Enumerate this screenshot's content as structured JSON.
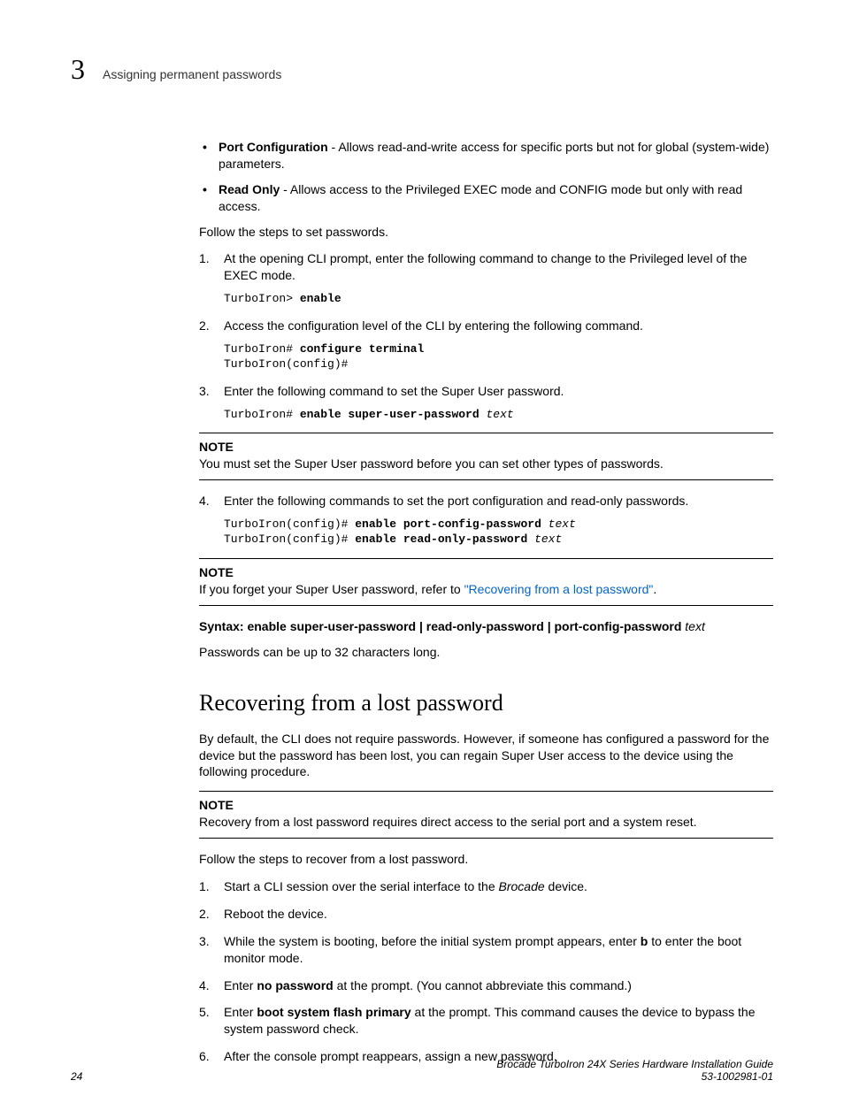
{
  "header": {
    "chapter": "3",
    "title": "Assigning permanent passwords"
  },
  "bullets": [
    {
      "term": "Port Configuration",
      "desc": " - Allows read-and-write access for specific ports but not for global (system-wide) parameters."
    },
    {
      "term": "Read Only",
      "desc": " - Allows access to the Privileged EXEC mode and CONFIG mode but only with read access."
    }
  ],
  "intro_follow": "Follow the steps to set passwords.",
  "steps": {
    "s1": "At the opening CLI prompt, enter the following command to change to the Privileged level of the EXEC mode.",
    "s1_code_prompt": "TurboIron> ",
    "s1_code_cmd": "enable",
    "s2": "Access the configuration level of the CLI by entering the following command.",
    "s2_code_l1_prompt": "TurboIron# ",
    "s2_code_l1_cmd": "configure terminal",
    "s2_code_l2": "TurboIron(config)#",
    "s3": "Enter the following command to set the Super User password.",
    "s3_code_prompt": "TurboIron# ",
    "s3_code_cmd": "enable super-user-password",
    "s3_code_arg": " text",
    "s4": "Enter the following commands to set the port configuration and read-only passwords.",
    "s4_code_l1_prompt": "TurboIron(config)# ",
    "s4_code_l1_cmd": "enable port-config-password",
    "s4_code_l1_arg": " text",
    "s4_code_l2_prompt": "TurboIron(config)# ",
    "s4_code_l2_cmd": "enable read-only-password",
    "s4_code_l2_arg": " text"
  },
  "note1": {
    "label": "NOTE",
    "text": "You must set the Super User password before you can set other types of passwords."
  },
  "note2": {
    "label": "NOTE",
    "text_pre": "If you forget your Super User password, refer to ",
    "link": "\"Recovering from a lost password\"",
    "text_post": "."
  },
  "syntax": {
    "label": "Syntax:  ",
    "cmd": "enable super-user-password | read-only-password | port-config-password",
    "arg": " text"
  },
  "para_pwlen": "Passwords can be up to 32 characters long.",
  "section2": {
    "heading": "Recovering from a lost password",
    "intro": "By default, the CLI does not require passwords. However, if someone has configured a password for the device but the password has been lost, you can regain Super User access to the device using the following procedure.",
    "note": {
      "label": "NOTE",
      "text": "Recovery from a lost password requires direct access to the serial port and a system reset."
    },
    "follow": "Follow the steps to recover from a lost password.",
    "steps": {
      "r1_pre": "Start a CLI session over the serial interface to the ",
      "r1_em": "Brocade",
      "r1_post": " device.",
      "r2": "Reboot the device.",
      "r3_pre": "While the system is booting, before the initial system prompt appears, enter ",
      "r3_b": "b",
      "r3_post": " to enter the boot monitor mode.",
      "r4_pre": "Enter ",
      "r4_b": "no password",
      "r4_post": " at the prompt. (You cannot abbreviate this command.)",
      "r5_pre": "Enter ",
      "r5_b": "boot system flash primary",
      "r5_post": " at the prompt. This command causes the device to bypass the system password check.",
      "r6": "After the console prompt reappears, assign a new password."
    }
  },
  "footer": {
    "page": "24",
    "title": "Brocade TurboIron 24X Series Hardware Installation Guide",
    "docnum": "53-1002981-01"
  }
}
